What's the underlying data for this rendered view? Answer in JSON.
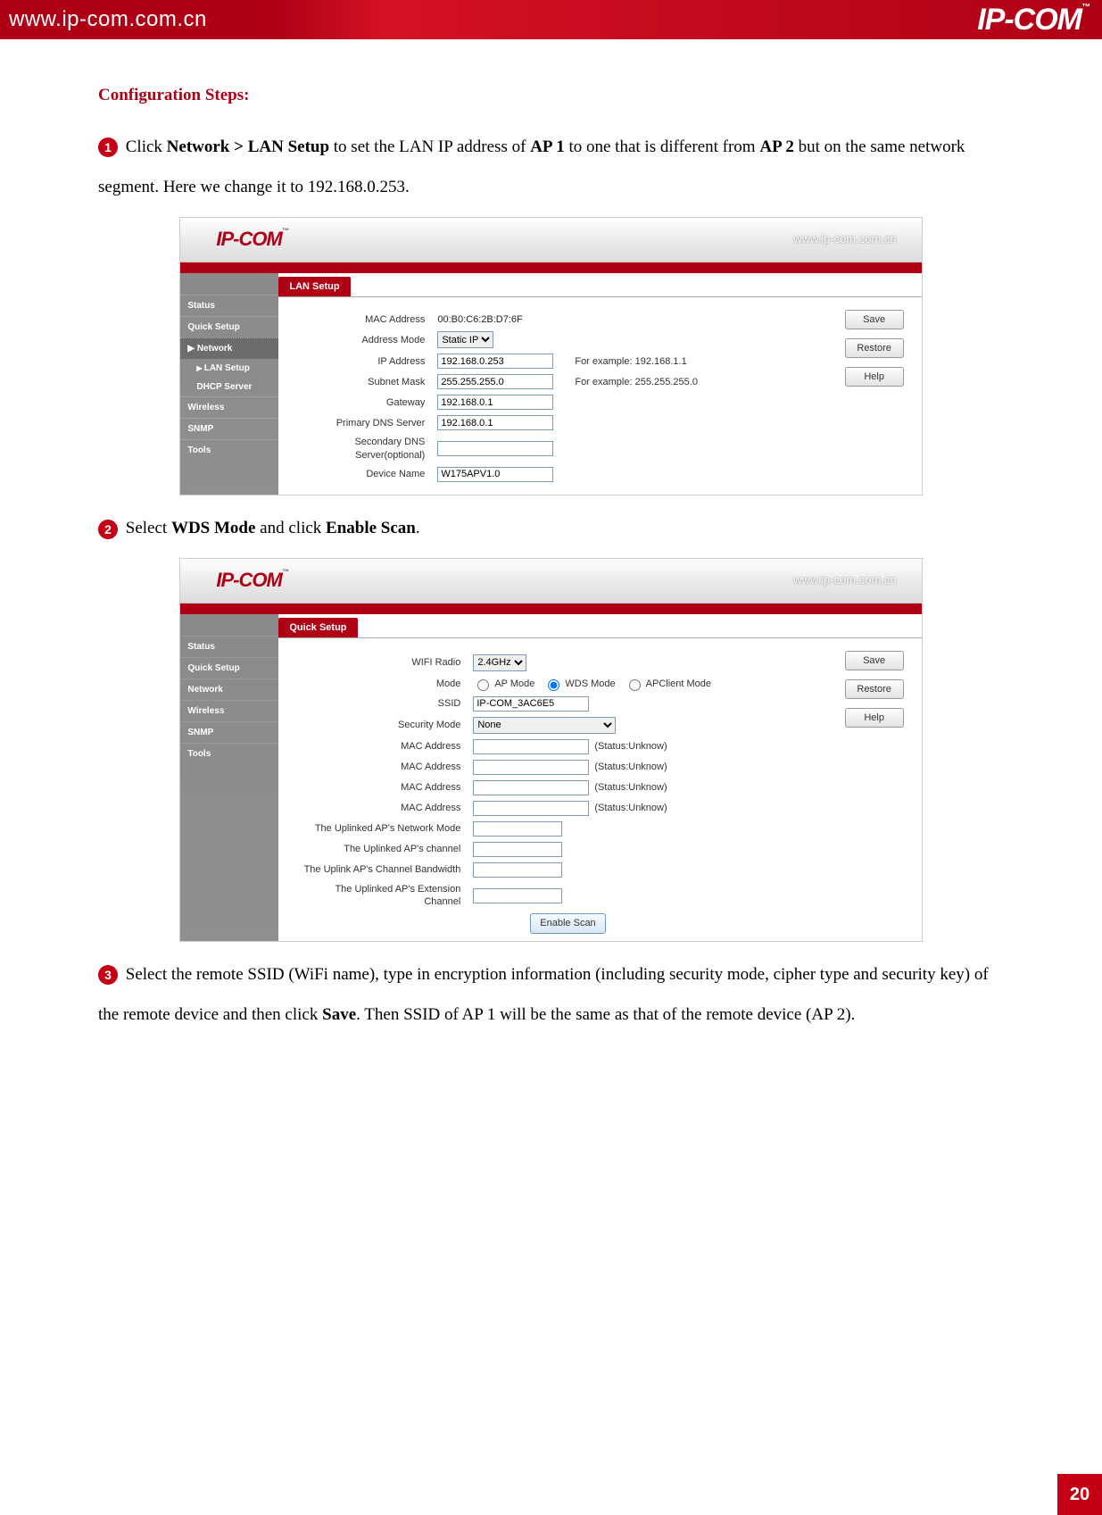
{
  "topBanner": {
    "url": "www.ip-com.com.cn",
    "brand": "IP-COM"
  },
  "configTitle": "Configuration Steps:",
  "step1": {
    "pre": " Click ",
    "bold1": "Network > LAN Setup",
    "mid": " to set the LAN IP address of ",
    "bold2": "AP 1",
    "mid2": " to one that is different from ",
    "bold3": "AP 2",
    "post": " but on the same network segment. Here we change it to 192.168.0.253."
  },
  "shot1": {
    "logo": "IP-COM",
    "url": "www.ip-com.com.cn",
    "tab": "LAN Setup",
    "nav": [
      "Status",
      "Quick Setup",
      "Network",
      "LAN Setup",
      "DHCP Server",
      "Wireless",
      "SNMP",
      "Tools"
    ],
    "labels": {
      "mac": "MAC Address",
      "macVal": "00:B0:C6:2B:D7:6F",
      "addrMode": "Address Mode",
      "addrModeVal": "Static IP",
      "ip": "IP Address",
      "ipVal": "192.168.0.253",
      "ipHint": "For example: 192.168.1.1",
      "mask": "Subnet Mask",
      "maskVal": "255.255.255.0",
      "maskHint": "For example: 255.255.255.0",
      "gw": "Gateway",
      "gwVal": "192.168.0.1",
      "dns1": "Primary DNS Server",
      "dns1Val": "192.168.0.1",
      "dns2l1": "Secondary DNS",
      "dns2l2": "Server(optional)",
      "dns2Val": "",
      "dev": "Device Name",
      "devVal": "W175APV1.0"
    },
    "buttons": {
      "save": "Save",
      "restore": "Restore",
      "help": "Help"
    }
  },
  "step2": {
    "pre": " Select ",
    "bold1": "WDS Mode",
    "mid": " and click ",
    "bold2": "Enable Scan",
    "post": "."
  },
  "shot2": {
    "logo": "IP-COM",
    "url": "www.ip-com.com.cn",
    "tab": "Quick Setup",
    "nav": [
      "Status",
      "Quick Setup",
      "Network",
      "Wireless",
      "SNMP",
      "Tools"
    ],
    "labels": {
      "wifi": "WIFI Radio",
      "wifiVal": "2.4GHz",
      "mode": "Mode",
      "modeAP": "AP Mode",
      "modeWDS": "WDS Mode",
      "modeClient": "APClient Mode",
      "ssid": "SSID",
      "ssidVal": "IP-COM_3AC6E5",
      "sec": "Security Mode",
      "secVal": "None",
      "mac": "MAC Address",
      "status": "(Status:Unknow)",
      "upNetMode": "The Uplinked AP's Network Mode",
      "upChan": "The Uplinked AP's channel",
      "upBw": "The Uplink AP's Channel Bandwidth",
      "upExt": "The Uplinked AP's Extension Channel",
      "scan": "Enable Scan"
    },
    "buttons": {
      "save": "Save",
      "restore": "Restore",
      "help": "Help"
    }
  },
  "step3": {
    "pre": " Select the remote SSID (WiFi name), type in encryption information (including security mode, cipher type and security key) of the remote device and then click ",
    "bold1": "Save",
    "post": ". Then SSID of AP 1 will be the same as that of the remote device (AP 2)."
  },
  "pageNumber": "20"
}
